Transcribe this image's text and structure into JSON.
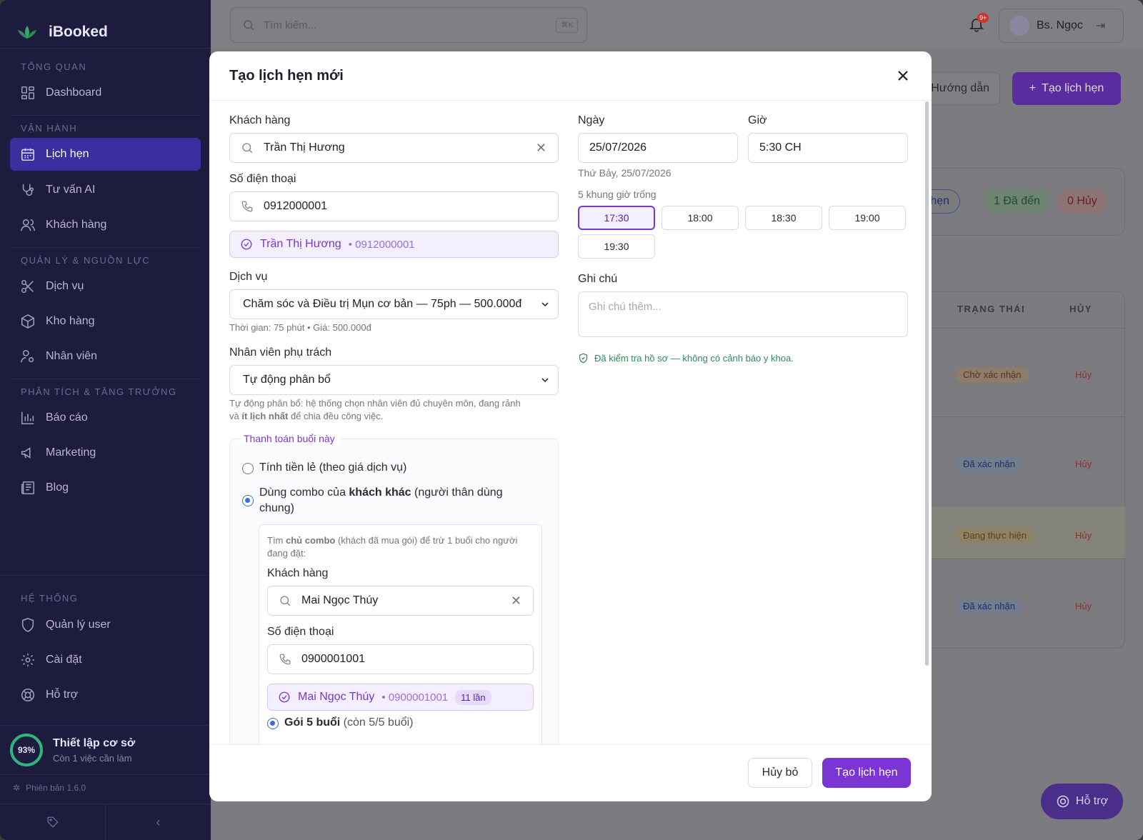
{
  "app": {
    "name": "iBooked",
    "version": "Phiên bản 1.6.0"
  },
  "sidebar": {
    "sections": [
      {
        "title": "TỔNG QUAN",
        "items": [
          {
            "label": "Dashboard",
            "icon": "dashboard-icon"
          }
        ]
      },
      {
        "title": "VẬN HÀNH",
        "items": [
          {
            "label": "Lịch hẹn",
            "icon": "calendar-icon",
            "active": true
          },
          {
            "label": "Tư vấn AI",
            "icon": "stethoscope-icon"
          },
          {
            "label": "Khách hàng",
            "icon": "users-icon"
          }
        ]
      },
      {
        "title": "QUẢN LÝ & NGUỒN LỰC",
        "items": [
          {
            "label": "Dịch vụ",
            "icon": "scissors-icon"
          },
          {
            "label": "Kho hàng",
            "icon": "box-icon"
          },
          {
            "label": "Nhân viên",
            "icon": "user-gear-icon"
          }
        ]
      },
      {
        "title": "PHÂN TÍCH & TĂNG TRƯỞNG",
        "items": [
          {
            "label": "Báo cáo",
            "icon": "bar-chart-icon"
          },
          {
            "label": "Marketing",
            "icon": "megaphone-icon"
          },
          {
            "label": "Blog",
            "icon": "newspaper-icon"
          }
        ]
      },
      {
        "title": "HỆ THỐNG",
        "items": [
          {
            "label": "Quản lý user",
            "icon": "shield-icon"
          },
          {
            "label": "Cài đặt",
            "icon": "gear-icon"
          },
          {
            "label": "Hỗ trợ",
            "icon": "lifebuoy-icon"
          }
        ]
      }
    ],
    "setup": {
      "percent": "93%",
      "progress": 0.93,
      "title": "Thiết lập cơ sở",
      "subtitle": "Còn 1 việc cần làm"
    }
  },
  "topbar": {
    "search_placeholder": "Tìm kiếm...",
    "shortcut": "⌘K",
    "notif_badge": "9+",
    "user_name": "Bs. Ngọc"
  },
  "page": {
    "guide_label": "Hướng dẫn",
    "new_label": "Tạo lịch hẹn",
    "pills": [
      "ch hẹn",
      "1 Đã đến",
      "0 Hủy"
    ],
    "table_headers": [
      "TRẠNG THÁI",
      "HỦY"
    ],
    "rows": [
      {
        "status": "Chờ xác nhận",
        "cancel": "Hủy"
      },
      {
        "status": "Đã xác nhận",
        "cancel": "Hủy"
      },
      {
        "status": "Đang thực hiện",
        "cancel": "Hủy"
      },
      {
        "status": "Đã xác nhận",
        "cancel": "Hủy"
      }
    ],
    "help_label": "Hỗ trợ"
  },
  "modal": {
    "title": "Tạo lịch hẹn mới",
    "customer_label": "Khách hàng",
    "customer_value": "Trần Thị Hương",
    "phone_label": "Số điện thoại",
    "phone_value": "0912000001",
    "customer_chip_name": "Trần Thị Hương",
    "customer_chip_phone": "• 0912000001",
    "service_label": "Dịch vụ",
    "service_value": "Chăm sóc và Điều trị Mụn cơ bản — 75ph — 500.000đ",
    "service_hint": "Thời gian: 75 phút • Giá: 500.000đ",
    "staff_label": "Nhân viên phụ trách",
    "staff_value": "Tự động phân bổ",
    "staff_hint_1": "Tự động phân bổ: hệ thống chọn nhân viên đủ chuyên môn, đang rảnh",
    "staff_hint_2a": "và ",
    "staff_hint_2b": "ít lịch nhất",
    "staff_hint_2c": " để chia đều công việc.",
    "payment_legend": "Thanh toán buổi này",
    "pay_option_1": "Tính tiền lẻ (theo giá dịch vụ)",
    "pay_option_2a": "Dùng combo của ",
    "pay_option_2b": "khách khác",
    "pay_option_2c": " (người thân dùng",
    "pay_option_2d": "chung)",
    "combo_hint_a": "Tìm ",
    "combo_hint_b": "chủ combo",
    "combo_hint_c": " (khách đã mua gói) để trừ 1 buổi cho người",
    "combo_hint_d": "đang đặt:",
    "combo_customer_label": "Khách hàng",
    "combo_customer_value": "Mai Ngọc Thúy",
    "combo_phone_label": "Số điện thoại",
    "combo_phone_value": "0900001001",
    "combo_chip_name": "Mai Ngọc Thúy",
    "combo_chip_phone": "• 0900001001",
    "combo_chip_count": "11 lần",
    "package_name": "Gói 5 buổi",
    "package_remaining": " (còn 5/5 buổi)",
    "date_label": "Ngày",
    "date_value": "25/07/2026",
    "date_hint": "Thứ Bảy, 25/07/2026",
    "time_label": "Giờ",
    "time_value": "5:30 CH",
    "slots_label": "5 khung giờ trống",
    "slots": [
      "17:30",
      "18:00",
      "18:30",
      "19:00",
      "19:30"
    ],
    "selected_slot": "17:30",
    "note_label": "Ghi chú",
    "note_placeholder": "Ghi chú thêm...",
    "medical_check": "Đã kiểm tra hồ sơ — không có cảnh báo y khoa.",
    "cancel_button": "Hủy bỏ",
    "submit_button": "Tạo lịch hẹn"
  },
  "colors": {
    "accent": "#7a35d4",
    "sidebar": "#1d1b3e",
    "success": "#2e8b57"
  }
}
